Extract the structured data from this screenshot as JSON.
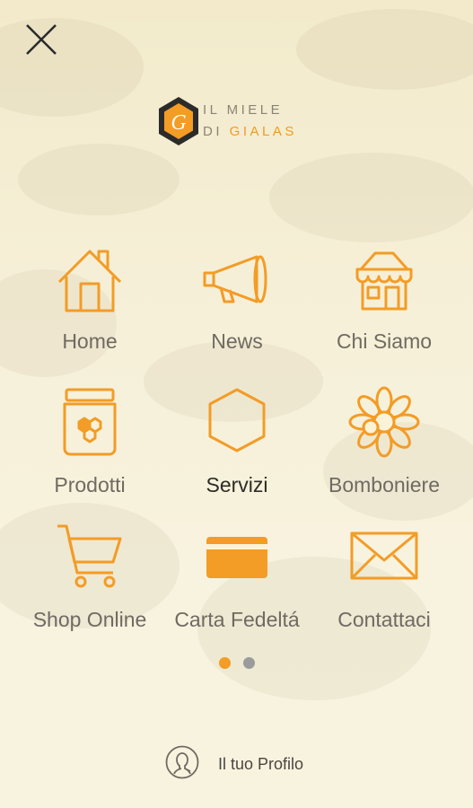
{
  "colors": {
    "accent": "#f39c26",
    "label": "#6f6a62",
    "active_label": "#2e2b27",
    "dot_inactive": "#9b9b9b"
  },
  "header": {
    "close_icon": "close-icon"
  },
  "logo": {
    "letter": "G",
    "line1": "IL MIELE",
    "line2_prefix": "DI ",
    "line2_accent": "GIALAS"
  },
  "menu": {
    "items": [
      {
        "label": "Home",
        "icon": "home-icon"
      },
      {
        "label": "News",
        "icon": "megaphone-icon"
      },
      {
        "label": "Chi Siamo",
        "icon": "shop-icon"
      },
      {
        "label": "Prodotti",
        "icon": "honey-jar-icon"
      },
      {
        "label": "Servizi",
        "icon": "hexagon-icon"
      },
      {
        "label": "Bomboniere",
        "icon": "flower-icon"
      },
      {
        "label": "Shop Online",
        "icon": "cart-icon"
      },
      {
        "label": "Carta Fedeltá",
        "icon": "card-icon"
      },
      {
        "label": "Contattaci",
        "icon": "envelope-icon"
      }
    ]
  },
  "pager": {
    "pages": 2,
    "current": 1
  },
  "profile": {
    "label": "Il tuo Profilo",
    "icon": "profile-icon"
  }
}
